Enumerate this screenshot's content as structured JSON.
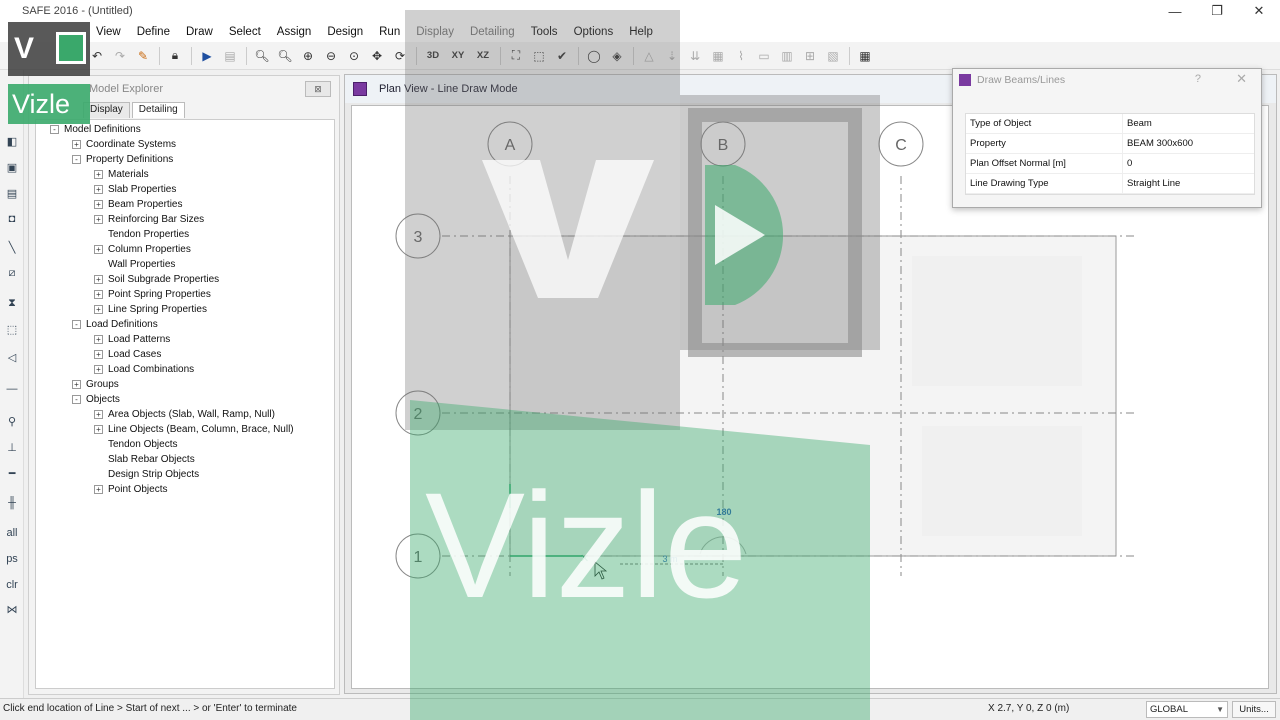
{
  "window": {
    "title": "SAFE 2016 - (Untitled)",
    "minimize": "—",
    "restore": "❐",
    "close": "✕"
  },
  "menu": [
    {
      "label": "View",
      "enabled": true
    },
    {
      "label": "Define",
      "enabled": true
    },
    {
      "label": "Draw",
      "enabled": true
    },
    {
      "label": "Select",
      "enabled": true
    },
    {
      "label": "Assign",
      "enabled": true
    },
    {
      "label": "Design",
      "enabled": true
    },
    {
      "label": "Run",
      "enabled": true
    },
    {
      "label": "Display",
      "enabled": false
    },
    {
      "label": "Detailing",
      "enabled": false
    },
    {
      "label": "Tools",
      "enabled": true
    },
    {
      "label": "Options",
      "enabled": true
    },
    {
      "label": "Help",
      "enabled": true
    }
  ],
  "toolbar": {
    "view_3d": "3D",
    "view_xy": "XY",
    "view_xz": "XZ"
  },
  "explorer": {
    "title": "Model Explorer",
    "close": "⊠",
    "tabs": [
      "Display",
      "Detailing"
    ],
    "tree": [
      {
        "label": "Model Definitions",
        "expand": "-"
      },
      {
        "label": "Coordinate Systems",
        "expand": "+"
      },
      {
        "label": "Property Definitions",
        "expand": "-"
      },
      {
        "label": "Materials",
        "expand": "+"
      },
      {
        "label": "Slab Properties",
        "expand": "+"
      },
      {
        "label": "Beam Properties",
        "expand": "+"
      },
      {
        "label": "Reinforcing Bar Sizes",
        "expand": "+"
      },
      {
        "label": "Tendon Properties",
        "expand": ""
      },
      {
        "label": "Column Properties",
        "expand": "+"
      },
      {
        "label": "Wall Properties",
        "expand": ""
      },
      {
        "label": "Soil Subgrade Properties",
        "expand": "+"
      },
      {
        "label": "Point Spring Properties",
        "expand": "+"
      },
      {
        "label": "Line Spring Properties",
        "expand": "+"
      },
      {
        "label": "Load Definitions",
        "expand": "-"
      },
      {
        "label": "Load Patterns",
        "expand": "+"
      },
      {
        "label": "Load Cases",
        "expand": "+"
      },
      {
        "label": "Load Combinations",
        "expand": "+"
      },
      {
        "label": "Groups",
        "expand": "+"
      },
      {
        "label": "Objects",
        "expand": "-"
      },
      {
        "label": "Area Objects (Slab, Wall, Ramp, Null)",
        "expand": "+"
      },
      {
        "label": "Line Objects (Beam, Column, Brace, Null)",
        "expand": "+"
      },
      {
        "label": "Tendon Objects",
        "expand": ""
      },
      {
        "label": "Slab Rebar Objects",
        "expand": ""
      },
      {
        "label": "Design Strip Objects",
        "expand": ""
      },
      {
        "label": "Point Objects",
        "expand": "+"
      }
    ]
  },
  "plan": {
    "title": "Plan View - Line Draw Mode",
    "grid_x": [
      "A",
      "B",
      "C"
    ],
    "grid_y": [
      "3",
      "2",
      "1"
    ],
    "dim_length": "3 m",
    "dim_angle": "180"
  },
  "dialog": {
    "title": "Draw Beams/Lines",
    "help": "?",
    "close": "✕",
    "rows": [
      {
        "key": "Type of Object",
        "value": "Beam"
      },
      {
        "key": "Property",
        "value": "BEAM 300x600"
      },
      {
        "key": "Plan Offset Normal  [m]",
        "value": "0"
      },
      {
        "key": "Line Drawing Type",
        "value": "Straight Line"
      }
    ]
  },
  "status": {
    "message": "Click end location of Line > Start of next ... > or 'Enter' to terminate",
    "coords": "X 2.7,  Y 0,  Z 0  (m)",
    "coord_system": "GLOBAL",
    "units": "Units..."
  },
  "watermark": {
    "brand": "Vizle",
    "letter": "V"
  }
}
